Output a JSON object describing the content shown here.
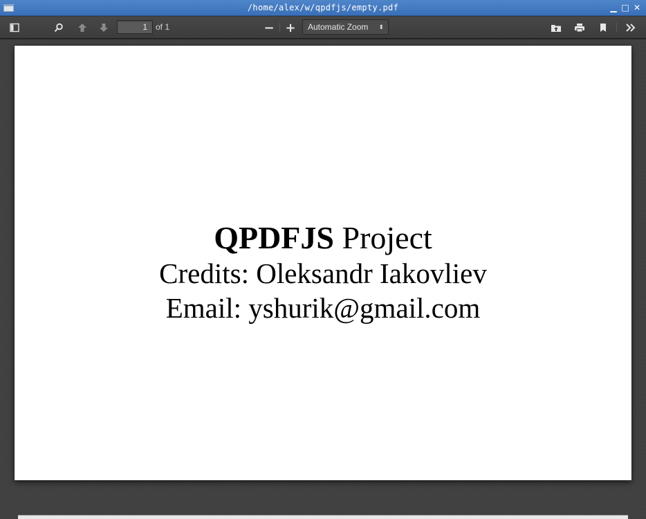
{
  "window": {
    "title": "/home/alex/w/qpdfjs/empty.pdf",
    "minimize_glyph": "▁",
    "maximize_glyph": "□",
    "close_glyph": "✕"
  },
  "toolbar": {
    "page_number": "1",
    "page_count": "of 1",
    "zoom_out_glyph": "−",
    "zoom_in_glyph": "+",
    "zoom_value": "Automatic Zoom",
    "zoom_caret": "⬍",
    "icons": [
      "sidebar-toggle-icon",
      "search-icon",
      "previous-page-icon",
      "next-page-icon",
      "zoom-out-icon",
      "zoom-in-icon",
      "open-file-icon",
      "print-icon",
      "bookmark-icon",
      "tools-icon"
    ]
  },
  "document": {
    "title_bold": "QPDFJS",
    "title_rest": " Project",
    "credits": "Credits: Oleksandr Iakovliev",
    "email": "Email: yshurik@gmail.com"
  }
}
